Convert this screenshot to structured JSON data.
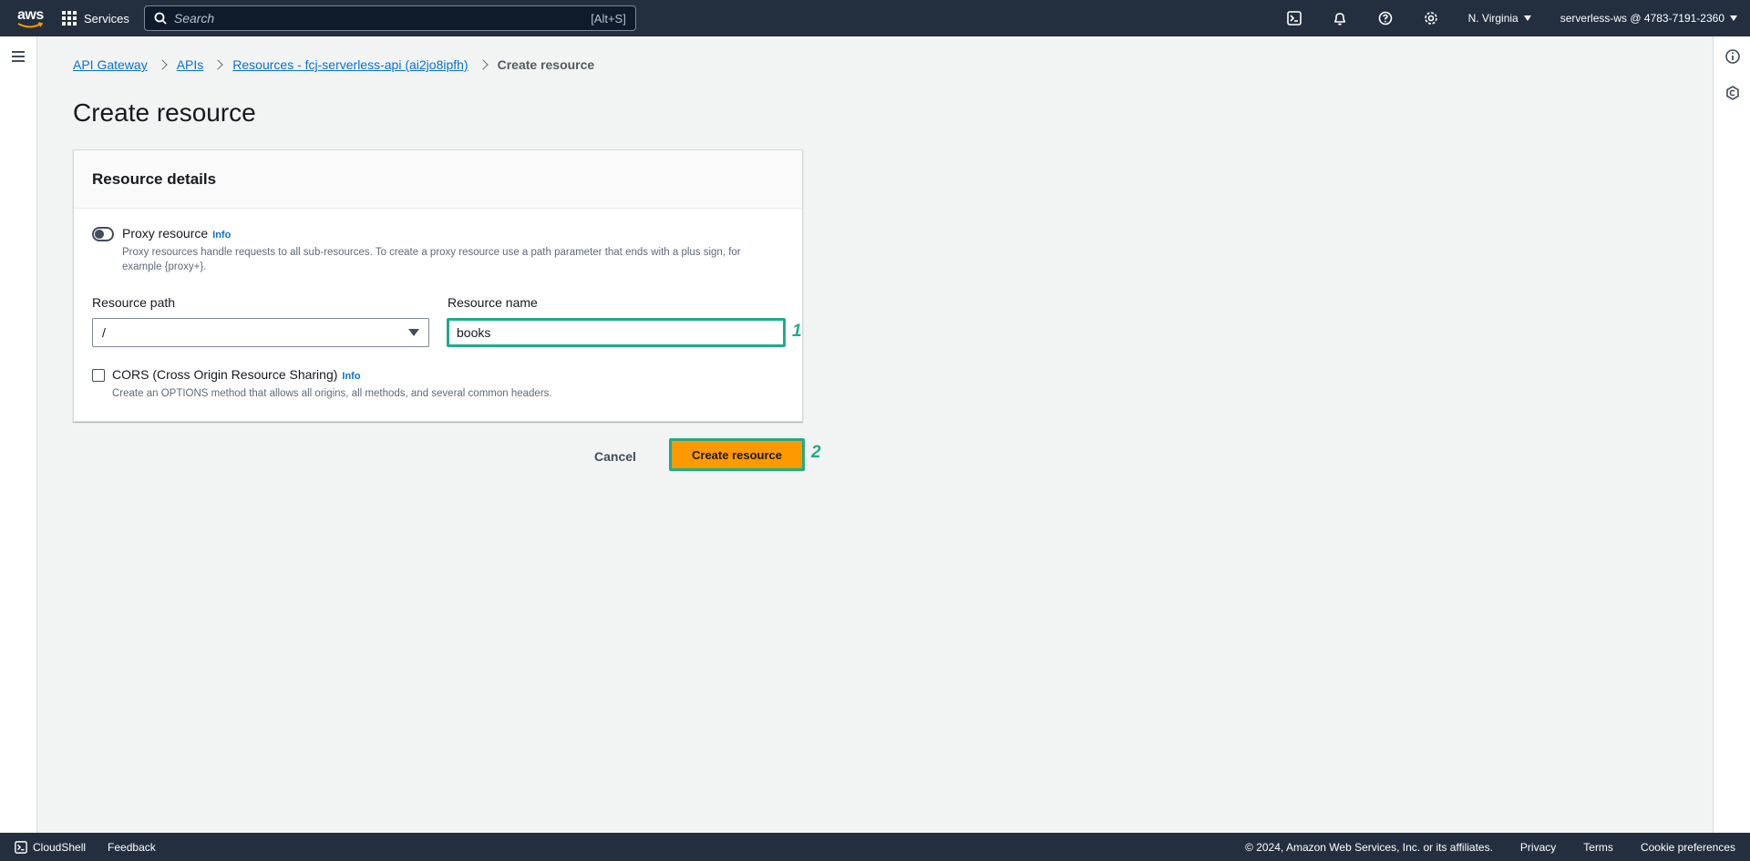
{
  "nav": {
    "logo_text": "aws",
    "services_label": "Services",
    "search_placeholder": "Search",
    "search_shortcut": "[Alt+S]",
    "region": "N. Virginia",
    "account": "serverless-ws @ 4783-7191-2360"
  },
  "breadcrumb": {
    "items": [
      "API Gateway",
      "APIs",
      "Resources - fcj-serverless-api (ai2jo8ipfh)"
    ],
    "current": "Create resource"
  },
  "page": {
    "title": "Create resource"
  },
  "panel": {
    "header": "Resource details",
    "proxy": {
      "label": "Proxy resource",
      "info": "Info",
      "description": "Proxy resources handle requests to all sub-resources. To create a proxy resource use a path parameter that ends with a plus sign, for example {proxy+}.",
      "enabled": false
    },
    "resource_path": {
      "label": "Resource path",
      "value": "/"
    },
    "resource_name": {
      "label": "Resource name",
      "value": "books"
    },
    "cors": {
      "label": "CORS (Cross Origin Resource Sharing)",
      "info": "Info",
      "description": "Create an OPTIONS method that allows all origins, all methods, and several common headers.",
      "checked": false
    }
  },
  "actions": {
    "cancel": "Cancel",
    "create": "Create resource"
  },
  "annotations": {
    "step1": "1",
    "step2": "2",
    "color": "#1fab89"
  },
  "footer": {
    "cloudshell": "CloudShell",
    "feedback": "Feedback",
    "copyright": "© 2024, Amazon Web Services, Inc. or its affiliates.",
    "privacy": "Privacy",
    "terms": "Terms",
    "cookies": "Cookie preferences"
  },
  "colors": {
    "nav_bg": "#232f3e",
    "link": "#0972d3",
    "primary_button": "#ff9900"
  }
}
